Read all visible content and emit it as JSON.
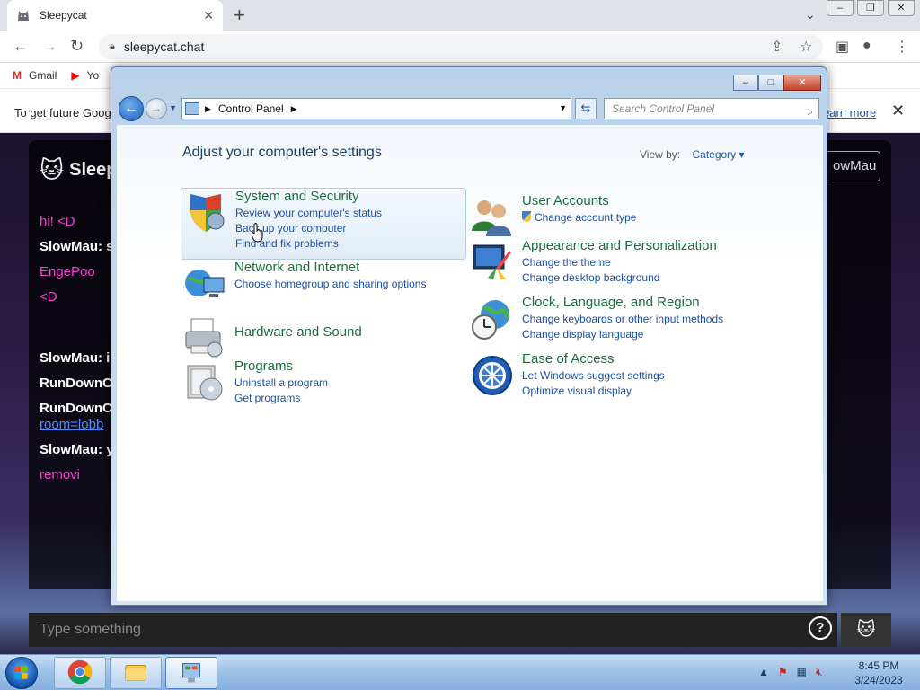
{
  "browser": {
    "tab_title": "Sleepycat",
    "tab_close": "✕",
    "new_tab": "+",
    "url": "sleepycat.chat",
    "bookmarks": [
      {
        "icon": "M",
        "label": "Gmail"
      },
      {
        "icon": "▶",
        "label": "Yo"
      }
    ],
    "infobar": {
      "message": "To get future Goog",
      "link": "earn more",
      "close": "✕"
    }
  },
  "sleepycat": {
    "logo": "Sleep",
    "user_button": "owMau",
    "messages": [
      {
        "text": "hi! <D",
        "style": "pink"
      },
      {
        "text": "SlowMau: s",
        "style": "white"
      },
      {
        "text": "EngePoo",
        "style": "pink"
      },
      {
        "text": "<D",
        "style": "pink"
      },
      {
        "text": "SlowMau: i",
        "style": "white"
      },
      {
        "text": "RunDownC",
        "style": "white"
      },
      {
        "text": "RunDownC",
        "style": "white"
      },
      {
        "text": "room=lobb",
        "style": "link"
      },
      {
        "text": "SlowMau: y",
        "style": "white"
      },
      {
        "text": "removi",
        "style": "pink"
      }
    ],
    "composer_placeholder": "Type something",
    "help": "?"
  },
  "control_panel": {
    "address": [
      "Control Panel"
    ],
    "search_placeholder": "Search Control Panel",
    "heading": "Adjust your computer's settings",
    "view_by_label": "View by:",
    "view_by_value": "Category",
    "categories_left": [
      {
        "name": "system-and-security",
        "icon": "shield-icon",
        "title": "System and Security",
        "links": [
          "Review your computer's status",
          "Back up your computer",
          "Find and fix problems"
        ],
        "highlighted": true
      },
      {
        "name": "network-and-internet",
        "icon": "network-icon",
        "title": "Network and Internet",
        "links": [
          "Choose homegroup and sharing options"
        ]
      },
      {
        "name": "hardware-and-sound",
        "icon": "printer-icon",
        "title": "Hardware and Sound",
        "links": []
      },
      {
        "name": "programs",
        "icon": "programs-icon",
        "title": "Programs",
        "links": [
          "Uninstall a program",
          "Get programs"
        ]
      }
    ],
    "categories_right": [
      {
        "name": "user-accounts",
        "icon": "users-icon",
        "title": "User Accounts",
        "links": [
          "Change account type"
        ]
      },
      {
        "name": "appearance-and-personalization",
        "icon": "appearance-icon",
        "title": "Appearance and Personalization",
        "links": [
          "Change the theme",
          "Change desktop background"
        ]
      },
      {
        "name": "clock-language-region",
        "icon": "clock-globe-icon",
        "title": "Clock, Language, and Region",
        "links": [
          "Change keyboards or other input methods",
          "Change display language"
        ]
      },
      {
        "name": "ease-of-access",
        "icon": "ease-of-access-icon",
        "title": "Ease of Access",
        "links": [
          "Let Windows suggest settings",
          "Optimize visual display"
        ]
      }
    ]
  },
  "taskbar": {
    "time": "8:45 PM",
    "date": "3/24/2023",
    "tray_arrow": "▲"
  },
  "colors": {
    "link_blue": "#1c4fa6",
    "category_green": "#1a6e3a",
    "heading_blue": "#1e3f66",
    "chat_pink": "#ff3ad4"
  }
}
